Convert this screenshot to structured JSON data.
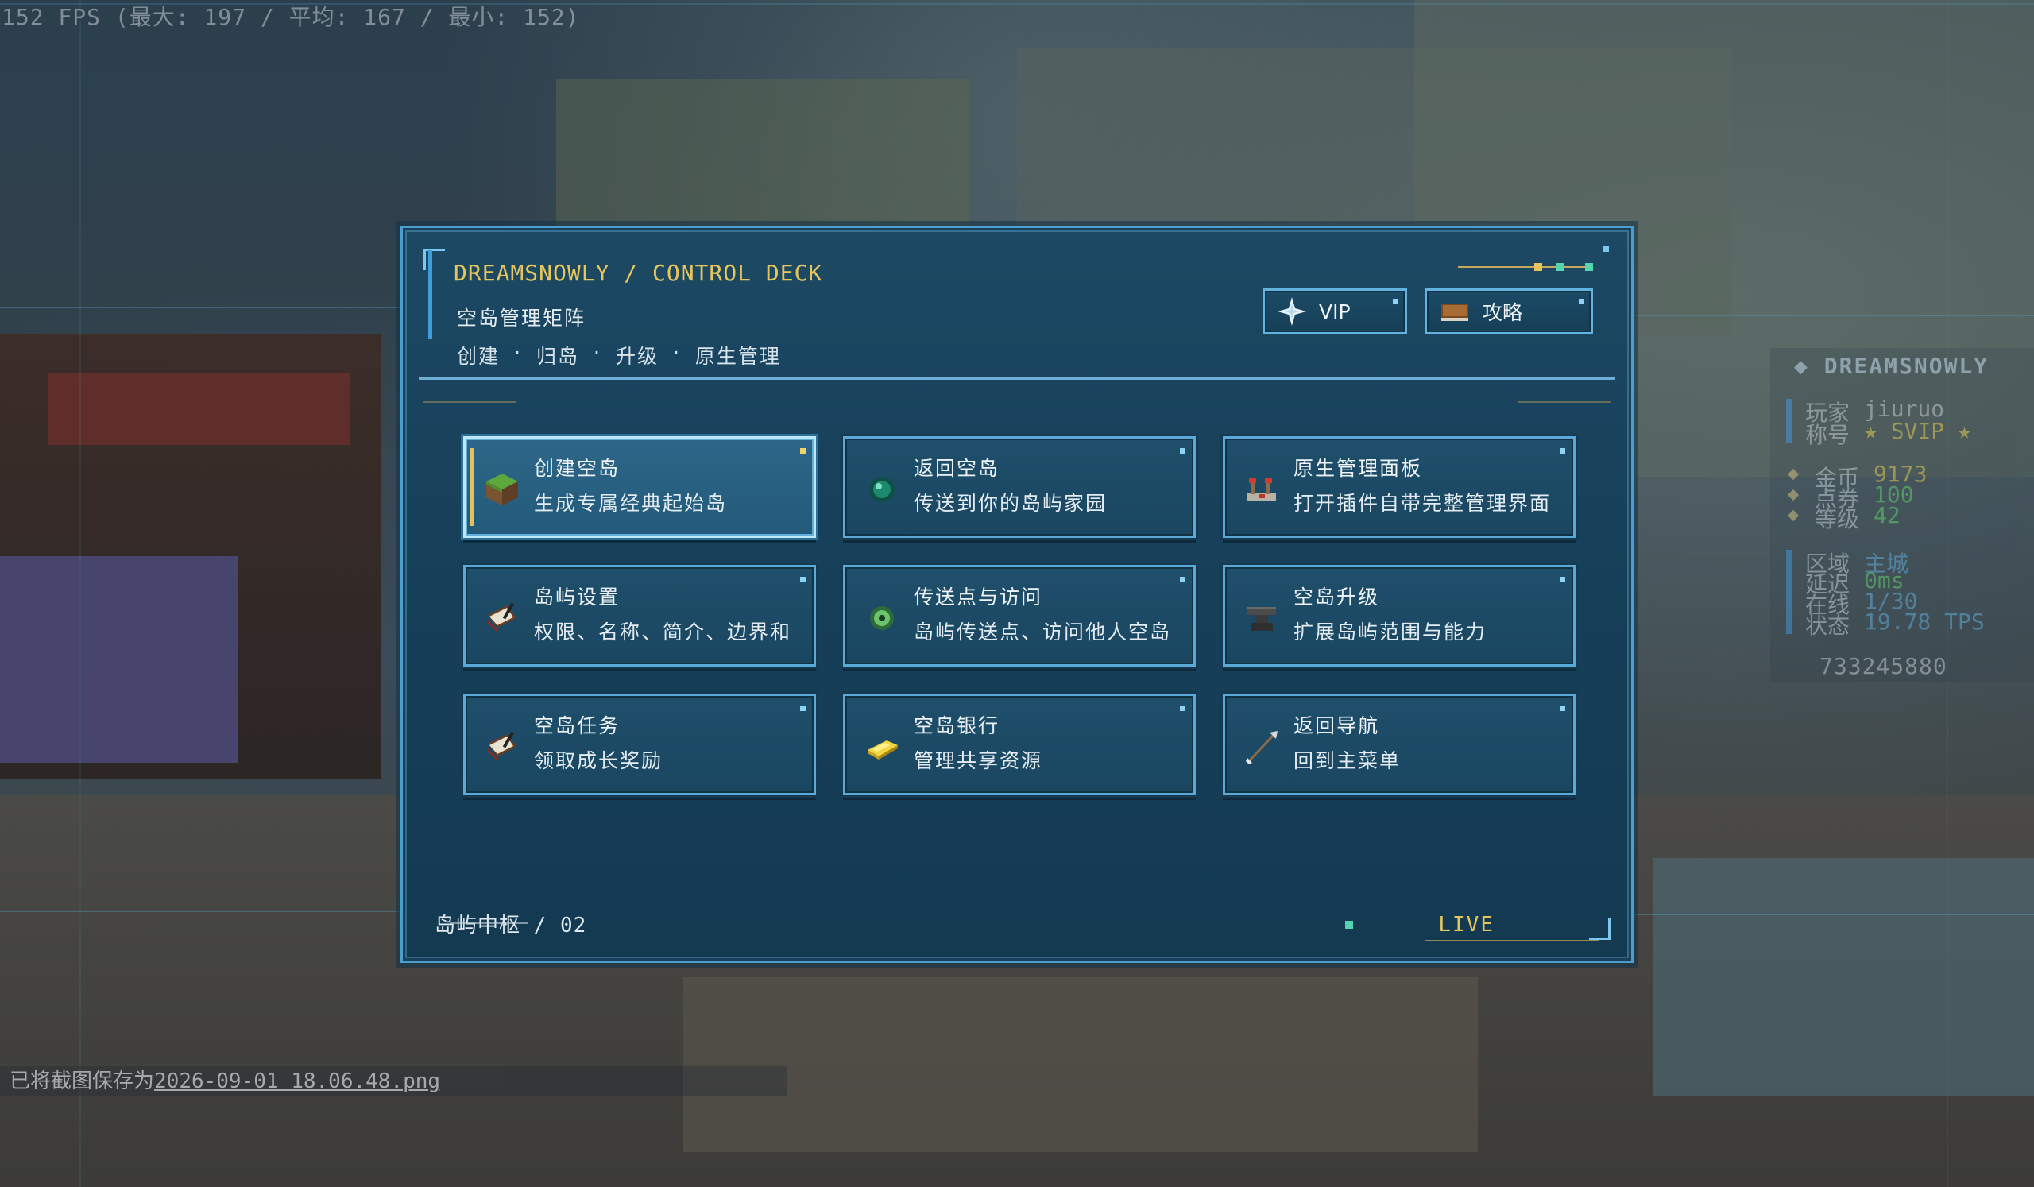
{
  "hud": {
    "fps": "152 FPS (最大: 197 / 平均: 167 / 最小: 152)",
    "saved_prefix": "已将截图保存为",
    "saved_file": "2026-09-01_18.06.48.png"
  },
  "scoreboard": {
    "brand": "DREAMSNOWLY",
    "player_label": "玩家",
    "player_value": "jiuruo",
    "title_label": "称号",
    "title_value": "SVIP",
    "coins_label": "金币",
    "coins_value": "9173",
    "points_label": "点券",
    "points_value": "100",
    "level_label": "等级",
    "level_value": "42",
    "zone_label": "区域",
    "zone_value": "主城",
    "ping_label": "延迟",
    "ping_value": "0ms",
    "online_label": "在线",
    "online_value": "1/30",
    "status_label": "状态",
    "status_value": "19.78 TPS",
    "server_id": "733245880"
  },
  "panel": {
    "brand": "DREAMSNOWLY / CONTROL DECK",
    "subtitle": "空岛管理矩阵",
    "crumbs": [
      "创建",
      "·",
      "归岛",
      "·",
      "升级",
      "·",
      "原生管理"
    ],
    "vip_label": "VIP",
    "guide_label": "攻略",
    "footer_left": "岛屿中枢 / 02",
    "footer_right": "LIVE"
  },
  "cards": [
    {
      "title": "创建空岛",
      "desc": "生成专属经典起始岛",
      "icon": "grass-block-icon"
    },
    {
      "title": "返回空岛",
      "desc": "传送到你的岛屿家园",
      "icon": "ender-pearl-icon"
    },
    {
      "title": "原生管理面板",
      "desc": "打开插件自带完整管理界面",
      "icon": "redstone-comparator-icon"
    },
    {
      "title": "岛屿设置",
      "desc": "权限、名称、简介、边界和",
      "icon": "book-quill-icon"
    },
    {
      "title": "传送点与访问",
      "desc": "岛屿传送点、访问他人空岛",
      "icon": "ender-eye-icon"
    },
    {
      "title": "空岛升级",
      "desc": "扩展岛屿范围与能力",
      "icon": "anvil-icon"
    },
    {
      "title": "空岛任务",
      "desc": "领取成长奖励",
      "icon": "book-quill-icon"
    },
    {
      "title": "空岛银行",
      "desc": "管理共享资源",
      "icon": "gold-ingot-icon"
    },
    {
      "title": "返回导航",
      "desc": "回到主菜单",
      "icon": "arrow-icon"
    }
  ],
  "colors": {
    "accent_gold": "#e6c65c",
    "panel_bg": "#17405a",
    "border": "#5aa9d6",
    "highlight": "#bfe7fb"
  }
}
